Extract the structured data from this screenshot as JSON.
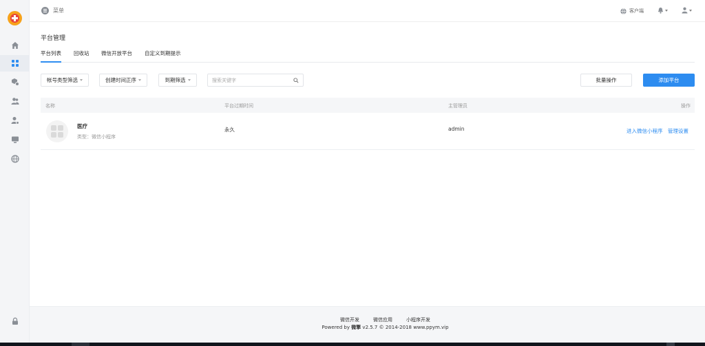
{
  "topbar": {
    "menu_label": "菜单",
    "client_label": "客户端"
  },
  "page": {
    "title": "平台管理",
    "tabs": [
      {
        "label": "平台列表",
        "active": true
      },
      {
        "label": "回收站",
        "active": false
      },
      {
        "label": "微信开放平台",
        "active": false
      },
      {
        "label": "自定义到期提示",
        "active": false
      }
    ]
  },
  "filters": {
    "account_type": "帐号类型筛选",
    "sort": "创建时间正序",
    "expire": "到期筛选",
    "search_placeholder": "搜索关键字",
    "batch_label": "批量操作",
    "add_label": "添加平台"
  },
  "table": {
    "headers": {
      "name": "名称",
      "expire": "平台过期时间",
      "admin": "主管理员",
      "action": "操作"
    },
    "rows": [
      {
        "name": "医疗",
        "type_label": "类型：",
        "type_value": "微信小程序",
        "expire": "永久",
        "admin": "admin",
        "actions": [
          "进入微信小程序",
          "管理设置"
        ]
      }
    ]
  },
  "footer": {
    "links": [
      "微信开发",
      "微信应用",
      "小程序开发"
    ],
    "powered_prefix": "Powered by ",
    "brand": "微擎",
    "powered_suffix": " v2.5.7 © 2014-2018 www.ppym.vip"
  },
  "colors": {
    "accent": "#2d8cf0",
    "logo_outer": "#f7a21b",
    "logo_inner": "#e8453c"
  }
}
